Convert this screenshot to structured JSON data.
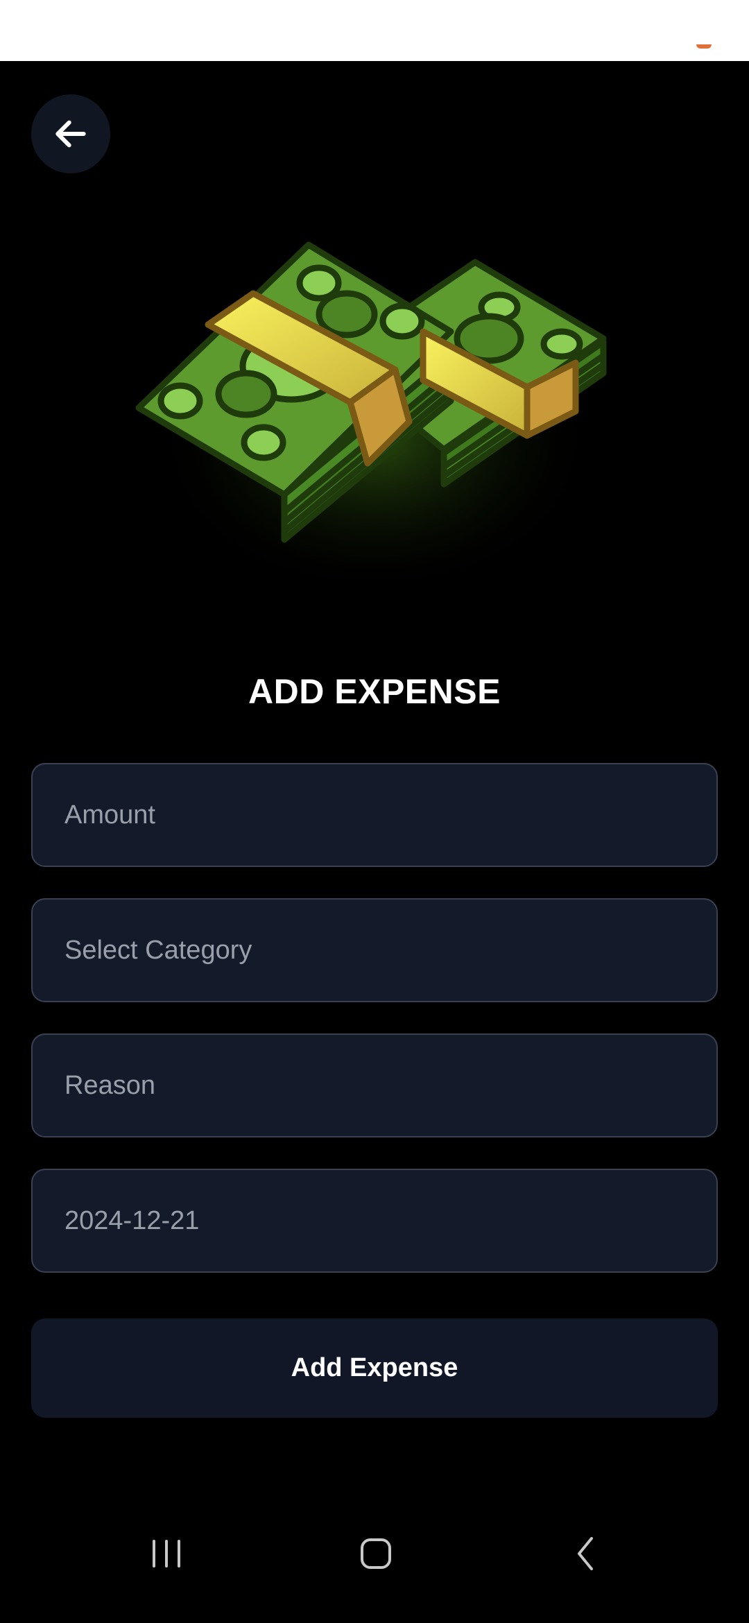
{
  "screen": {
    "title": "ADD EXPENSE",
    "hero_icon": "money-stack-icon"
  },
  "form": {
    "amount_placeholder": "Amount",
    "category_placeholder": "Select Category",
    "reason_placeholder": "Reason",
    "date_value": "2024-12-21",
    "submit_label": "Add Expense"
  },
  "nav": {
    "back_icon": "arrow-left-icon",
    "recents_icon": "recents-icon",
    "home_icon": "home-icon",
    "system_back_icon": "chevron-left-icon"
  },
  "colors": {
    "background": "#000000",
    "field_background": "#131a29",
    "field_border": "#3a4152",
    "placeholder_text": "#9aa0ab",
    "accent_orange": "#e0703a"
  }
}
